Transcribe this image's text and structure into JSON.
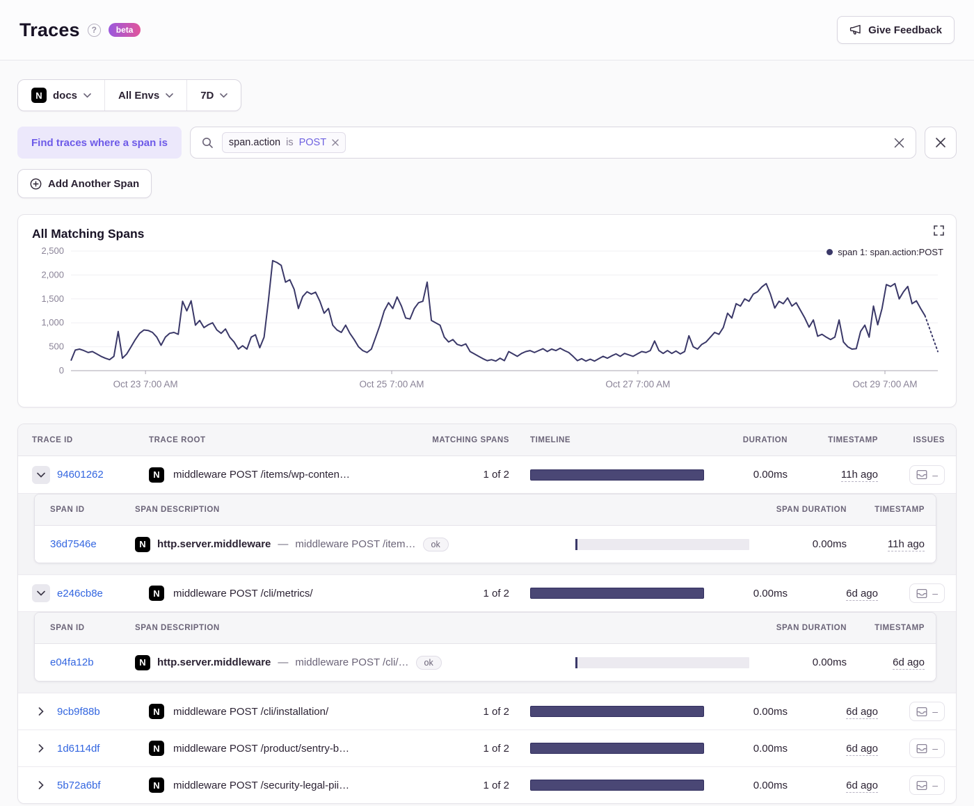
{
  "header": {
    "title": "Traces",
    "help_icon": "?",
    "beta_badge": "beta",
    "feedback_button": "Give Feedback"
  },
  "filters": {
    "project": "docs",
    "project_icon_letter": "N",
    "environment": "All Envs",
    "time_range": "7D"
  },
  "span_filter": {
    "label": "Find traces where a span is",
    "token": {
      "key": "span.action",
      "operator": "is",
      "value": "POST"
    },
    "add_button": "Add Another Span"
  },
  "chart": {
    "title": "All Matching Spans",
    "legend": "span 1: span.action:POST",
    "line_color": "#3a3868"
  },
  "chart_data": {
    "type": "line",
    "title": "All Matching Spans",
    "legend": [
      "span 1: span.action:POST"
    ],
    "legend_position": "top-right",
    "grid": "on",
    "ylim": [
      0,
      2500
    ],
    "ytick_labels": [
      "0",
      "500",
      "1,000",
      "1,500",
      "2,000",
      "2,500"
    ],
    "xticks": [
      {
        "label": "Oct 23 7:00 AM",
        "frac": 0.086
      },
      {
        "label": "Oct 25 7:00 AM",
        "frac": 0.37
      },
      {
        "label": "Oct 27 7:00 AM",
        "frac": 0.654
      },
      {
        "label": "Oct 29 7:00 AM",
        "frac": 0.939
      }
    ],
    "dotted_tail_points": 4,
    "series": [
      {
        "name": "span 1: span.action:POST",
        "values": [
          210,
          430,
          450,
          420,
          380,
          400,
          350,
          300,
          260,
          230,
          300,
          820,
          260,
          350,
          500,
          650,
          780,
          850,
          840,
          800,
          700,
          530,
          700,
          780,
          800,
          760,
          1450,
          1250,
          1460,
          950,
          1050,
          900,
          960,
          1000,
          850,
          780,
          870,
          700,
          600,
          450,
          520,
          450,
          700,
          750,
          480,
          700,
          1450,
          2300,
          2260,
          2200,
          1850,
          1900,
          1700,
          1300,
          1550,
          1650,
          1600,
          1640,
          1450,
          1200,
          1300,
          950,
          850,
          800,
          950,
          780,
          650,
          500,
          420,
          380,
          450,
          700,
          950,
          1250,
          1420,
          1300,
          1540,
          1350,
          1100,
          1080,
          1300,
          1420,
          1450,
          1850,
          1050,
          1000,
          950,
          700,
          600,
          650,
          550,
          520,
          560,
          400,
          350,
          300,
          250,
          210,
          230,
          200,
          260,
          210,
          400,
          350,
          300,
          360,
          400,
          420,
          380,
          420,
          460,
          400,
          450,
          420,
          470,
          420,
          380,
          300,
          210,
          250,
          200,
          240,
          200,
          250,
          300,
          260,
          310,
          350,
          300,
          360,
          330,
          300,
          350,
          400,
          380,
          420,
          620,
          420,
          360,
          420,
          360,
          410,
          350,
          400,
          730,
          500,
          450,
          550,
          600,
          700,
          800,
          760,
          900,
          1200,
          1100,
          1400,
          1350,
          1500,
          1450,
          1600,
          1650,
          1750,
          1820,
          1600,
          1310,
          1450,
          1400,
          1520,
          1350,
          1420,
          1260,
          1100,
          910,
          1060,
          720,
          760,
          700,
          650,
          700,
          1060,
          600,
          500,
          450,
          460,
          820,
          950,
          700,
          1350,
          960,
          1300,
          1800,
          1760,
          1820,
          1500,
          1650,
          1760,
          1400,
          1460,
          1300,
          1150,
          900,
          650,
          400
        ]
      }
    ]
  },
  "table": {
    "columns": [
      "TRACE ID",
      "TRACE ROOT",
      "MATCHING SPANS",
      "TIMELINE",
      "DURATION",
      "TIMESTAMP",
      "ISSUES"
    ],
    "span_columns": [
      "SPAN ID",
      "SPAN DESCRIPTION",
      "SPAN DURATION",
      "TIMESTAMP"
    ],
    "project_icon_letter": "N",
    "op_separator": "—",
    "issues_empty": "–",
    "rows": [
      {
        "trace_id": "94601262",
        "root": "middleware POST /items/wp-conten…",
        "matching": "1 of 2",
        "duration": "0.00ms",
        "timestamp": "11h ago",
        "expanded": true,
        "spans": [
          {
            "span_id": "36d7546e",
            "op": "http.server.middleware",
            "description": "middleware POST /item…",
            "status": "ok",
            "duration": "0.00ms",
            "timestamp": "11h ago"
          }
        ]
      },
      {
        "trace_id": "e246cb8e",
        "root": "middleware POST /cli/metrics/",
        "matching": "1 of 2",
        "duration": "0.00ms",
        "timestamp": "6d ago",
        "expanded": true,
        "spans": [
          {
            "span_id": "e04fa12b",
            "op": "http.server.middleware",
            "description": "middleware POST /cli/…",
            "status": "ok",
            "duration": "0.00ms",
            "timestamp": "6d ago"
          }
        ]
      },
      {
        "trace_id": "9cb9f88b",
        "root": "middleware POST /cli/installation/",
        "matching": "1 of 2",
        "duration": "0.00ms",
        "timestamp": "6d ago",
        "expanded": false
      },
      {
        "trace_id": "1d6114df",
        "root": "middleware POST /product/sentry-b…",
        "matching": "1 of 2",
        "duration": "0.00ms",
        "timestamp": "6d ago",
        "expanded": false
      },
      {
        "trace_id": "5b72a6bf",
        "root": "middleware POST /security-legal-pii…",
        "matching": "1 of 2",
        "duration": "0.00ms",
        "timestamp": "6d ago",
        "expanded": false
      }
    ]
  }
}
